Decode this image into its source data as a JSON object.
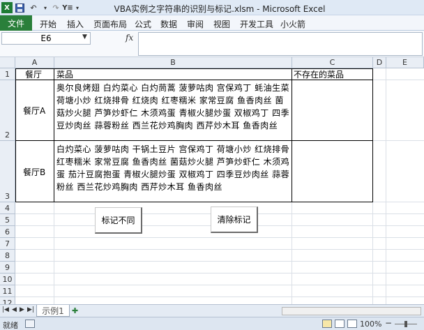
{
  "window": {
    "title": "VBA实例之字符串的识别与标记.xlsm - Microsoft Excel"
  },
  "qat": {
    "file_icon": "excel-icon",
    "save_icon": "save-icon",
    "undo_icon": "undo-icon",
    "redo_icon": "redo-icon",
    "custom_icon": "custom-command-icon"
  },
  "ribbon": {
    "tabs": [
      "文件",
      "开始",
      "插入",
      "页面布局",
      "公式",
      "数据",
      "审阅",
      "视图",
      "开发工具",
      "小火箭"
    ]
  },
  "formula_bar": {
    "name_box": "E6",
    "fx_label": "fx",
    "formula": ""
  },
  "sheet": {
    "columns": [
      "A",
      "B",
      "C",
      "D",
      "E"
    ],
    "rows": [
      "1",
      "2",
      "3",
      "4",
      "5",
      "6",
      "7",
      "8",
      "9",
      "10",
      "11",
      "12"
    ],
    "cells": {
      "A1": "餐厅",
      "B1": "菜品",
      "C1": "不存在的菜品",
      "A2": "餐厅A",
      "B2": "奥尔良烤翅 白灼菜心 白灼茼蒿 菠萝咕肉 宫保鸡丁 蚝油生菜 荷塘小炒 红烧排骨 红烧肉 红枣糯米 家常豆腐 鱼香肉丝 菌菇炒火腿 芦笋炒虾仁 木须鸡蛋 青椒火腿炒蛋 双椒鸡丁 四季豆炒肉丝 蒜蓉粉丝 西兰花炒鸡胸肉 西芹炒木耳 鱼香肉丝",
      "A3": "餐厅B",
      "B3": "白灼菜心 菠萝咕肉 干锅土豆片 宫保鸡丁 荷塘小炒 红烧排骨 红枣糯米 家常豆腐 鱼香肉丝 菌菇炒火腿 芦笋炒虾仁 木须鸡蛋 茄汁豆腐抱蛋 青椒火腿炒蛋 双椒鸡丁 四季豆炒肉丝 蒜蓉粉丝 西兰花炒鸡胸肉 西芹炒木耳 鱼香肉丝"
    }
  },
  "buttons": {
    "mark_diff": "标记不同",
    "clear_mark": "清除标记"
  },
  "sheet_tabs": {
    "tabs": [
      "示例1"
    ]
  },
  "status": {
    "ready": "就绪",
    "zoom": "100%"
  }
}
